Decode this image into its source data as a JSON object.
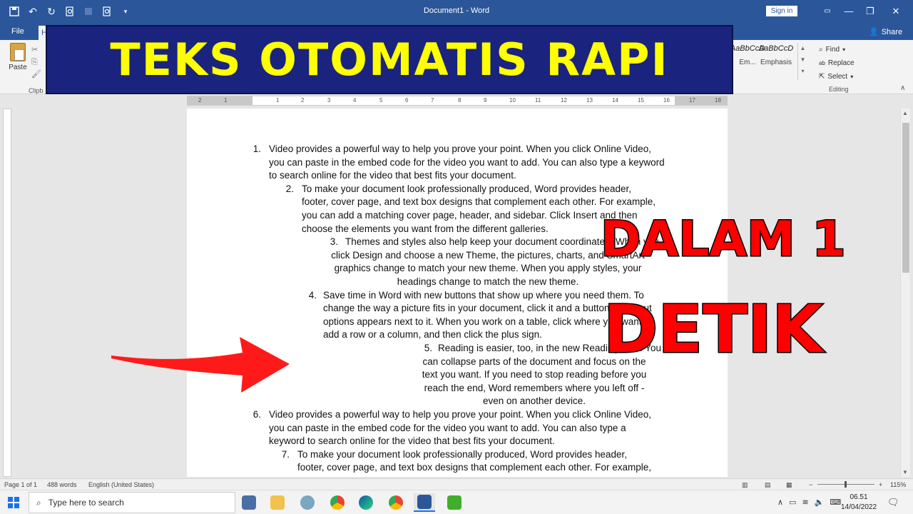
{
  "window": {
    "title": "Document1 - Word",
    "signin": "Sign in",
    "minimize": "—",
    "restore": "❐",
    "close": "✕"
  },
  "tabs": {
    "file": "File",
    "home": "H",
    "share": "Share"
  },
  "ribbon": {
    "paste": "Paste",
    "clipboard_group": "Clipb",
    "styles": [
      {
        "sample": "AaBbCcD",
        "label": "Em..."
      },
      {
        "sample": "AaBbCcD",
        "label": "Emphasis"
      }
    ],
    "editing": {
      "find": "Find",
      "replace": "Replace",
      "select": "Select",
      "group": "Editing"
    }
  },
  "banner": "TEKS OTOMATIS RAPI",
  "overlay": {
    "line1": "DALAM 1",
    "line2": "DETIK"
  },
  "ruler_numbers": [
    "2",
    "1",
    "1",
    "2",
    "3",
    "4",
    "5",
    "6",
    "7",
    "8",
    "9",
    "10",
    "11",
    "12",
    "13",
    "14",
    "15",
    "16",
    "17",
    "18"
  ],
  "document": {
    "items": [
      {
        "num": "1.",
        "lines": [
          "Video provides a powerful way to help you prove your point. When you click Online Video,",
          "you can paste in the embed code for the video you want to add. You can also type a keyword",
          "to search online for the video that best fits your document."
        ]
      },
      {
        "num": "2.",
        "lines": [
          "To make your document look professionally produced, Word provides header,",
          "footer, cover page, and text box designs that complement each other. For example,",
          "you can add a matching cover page, header, and sidebar. Click Insert and then",
          "choose the elements you want from the different galleries."
        ]
      },
      {
        "num": "3.",
        "lines": [
          "Themes and styles also help keep your document coordinated. When you",
          "click Design and choose a new Theme, the pictures, charts, and SmartArt",
          "graphics change to match your new theme. When you apply styles, your",
          "headings change to match the new theme."
        ]
      },
      {
        "num": "4.",
        "lines": [
          "Save time in Word with new buttons that show up where you need them. To",
          "change the way a picture fits in your document, click it and a button for layout",
          "options appears next to it. When you work on a table, click where you want to",
          "add a row or a column, and then click the plus sign."
        ]
      },
      {
        "num": "5.",
        "lines": [
          "Reading is easier, too, in the new Reading view. You",
          "can collapse parts of the document and focus on the",
          "text you want. If you need to stop reading before you",
          "reach the end, Word remembers where you left off -",
          "even on another device."
        ]
      },
      {
        "num": "6.",
        "lines": [
          "Video provides a powerful way to help you prove your point. When you click Online Video,",
          "you can paste in the embed code for the video you want to add. You can also type a",
          "keyword to search online for the video that best fits your document."
        ]
      },
      {
        "num": "7.",
        "lines": [
          "To make your document look professionally produced, Word provides header,",
          "footer, cover page, and text box designs that complement each other. For example,"
        ]
      }
    ]
  },
  "status": {
    "page": "Page 1 of 1",
    "words": "488 words",
    "language": "English (United States)",
    "zoom": "115%",
    "zoom_minus": "−",
    "zoom_plus": "+"
  },
  "taskbar": {
    "search_placeholder": "Type here to search",
    "time": "06.51",
    "date": "14/04/2022"
  },
  "colors": {
    "word_blue": "#2b579a",
    "banner_bg": "#1a237e",
    "banner_text": "#ffff00",
    "overlay_red": "#ff0000"
  }
}
